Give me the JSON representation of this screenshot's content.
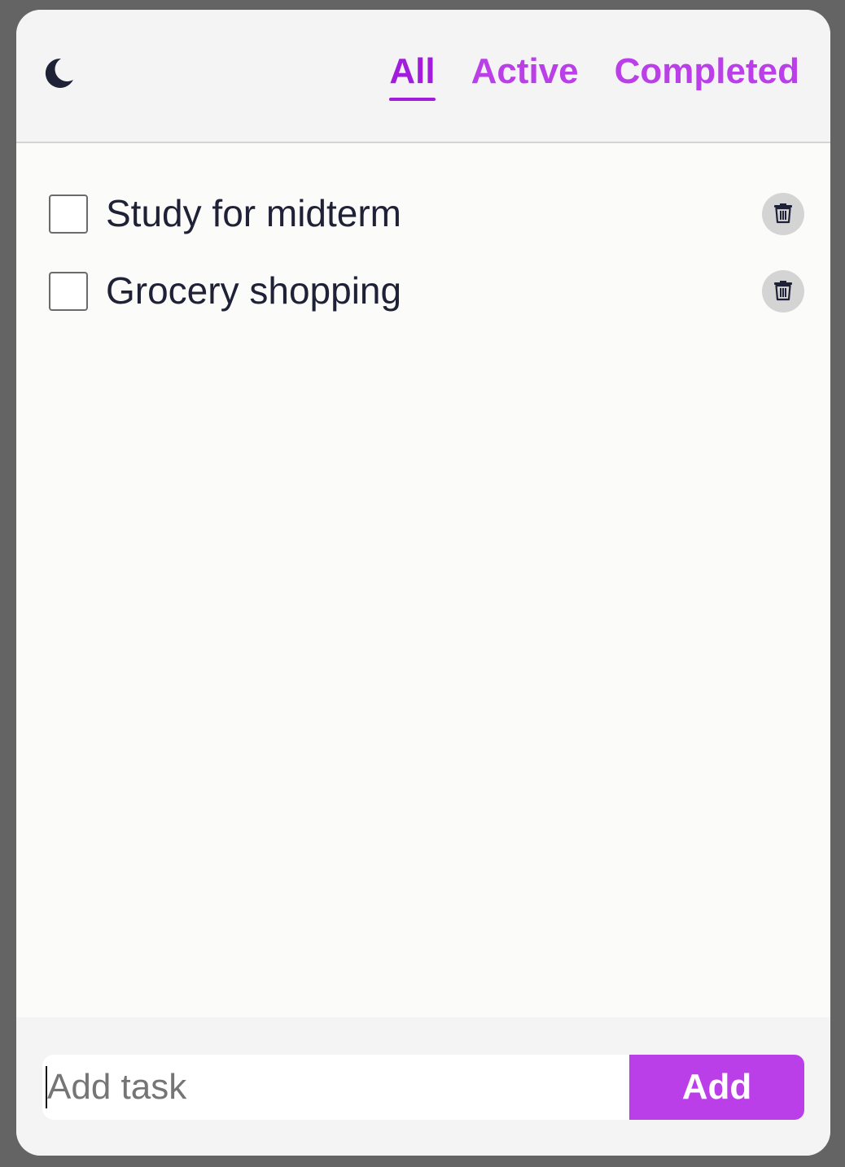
{
  "header": {
    "theme_toggle_icon": "moon-icon",
    "tabs": [
      {
        "label": "All",
        "active": true
      },
      {
        "label": "Active",
        "active": false
      },
      {
        "label": "Completed",
        "active": false
      }
    ]
  },
  "tasks": [
    {
      "label": "Study for midterm",
      "checked": false,
      "delete_icon": "trash-icon"
    },
    {
      "label": "Grocery shopping",
      "checked": false,
      "delete_icon": "trash-icon"
    }
  ],
  "footer": {
    "input_value": "",
    "input_placeholder": "Add task",
    "add_label": "Add"
  },
  "colors": {
    "accent": "#bb3fe8",
    "accent_active": "#a21cdb",
    "text": "#1f2136",
    "background": "#646464"
  }
}
